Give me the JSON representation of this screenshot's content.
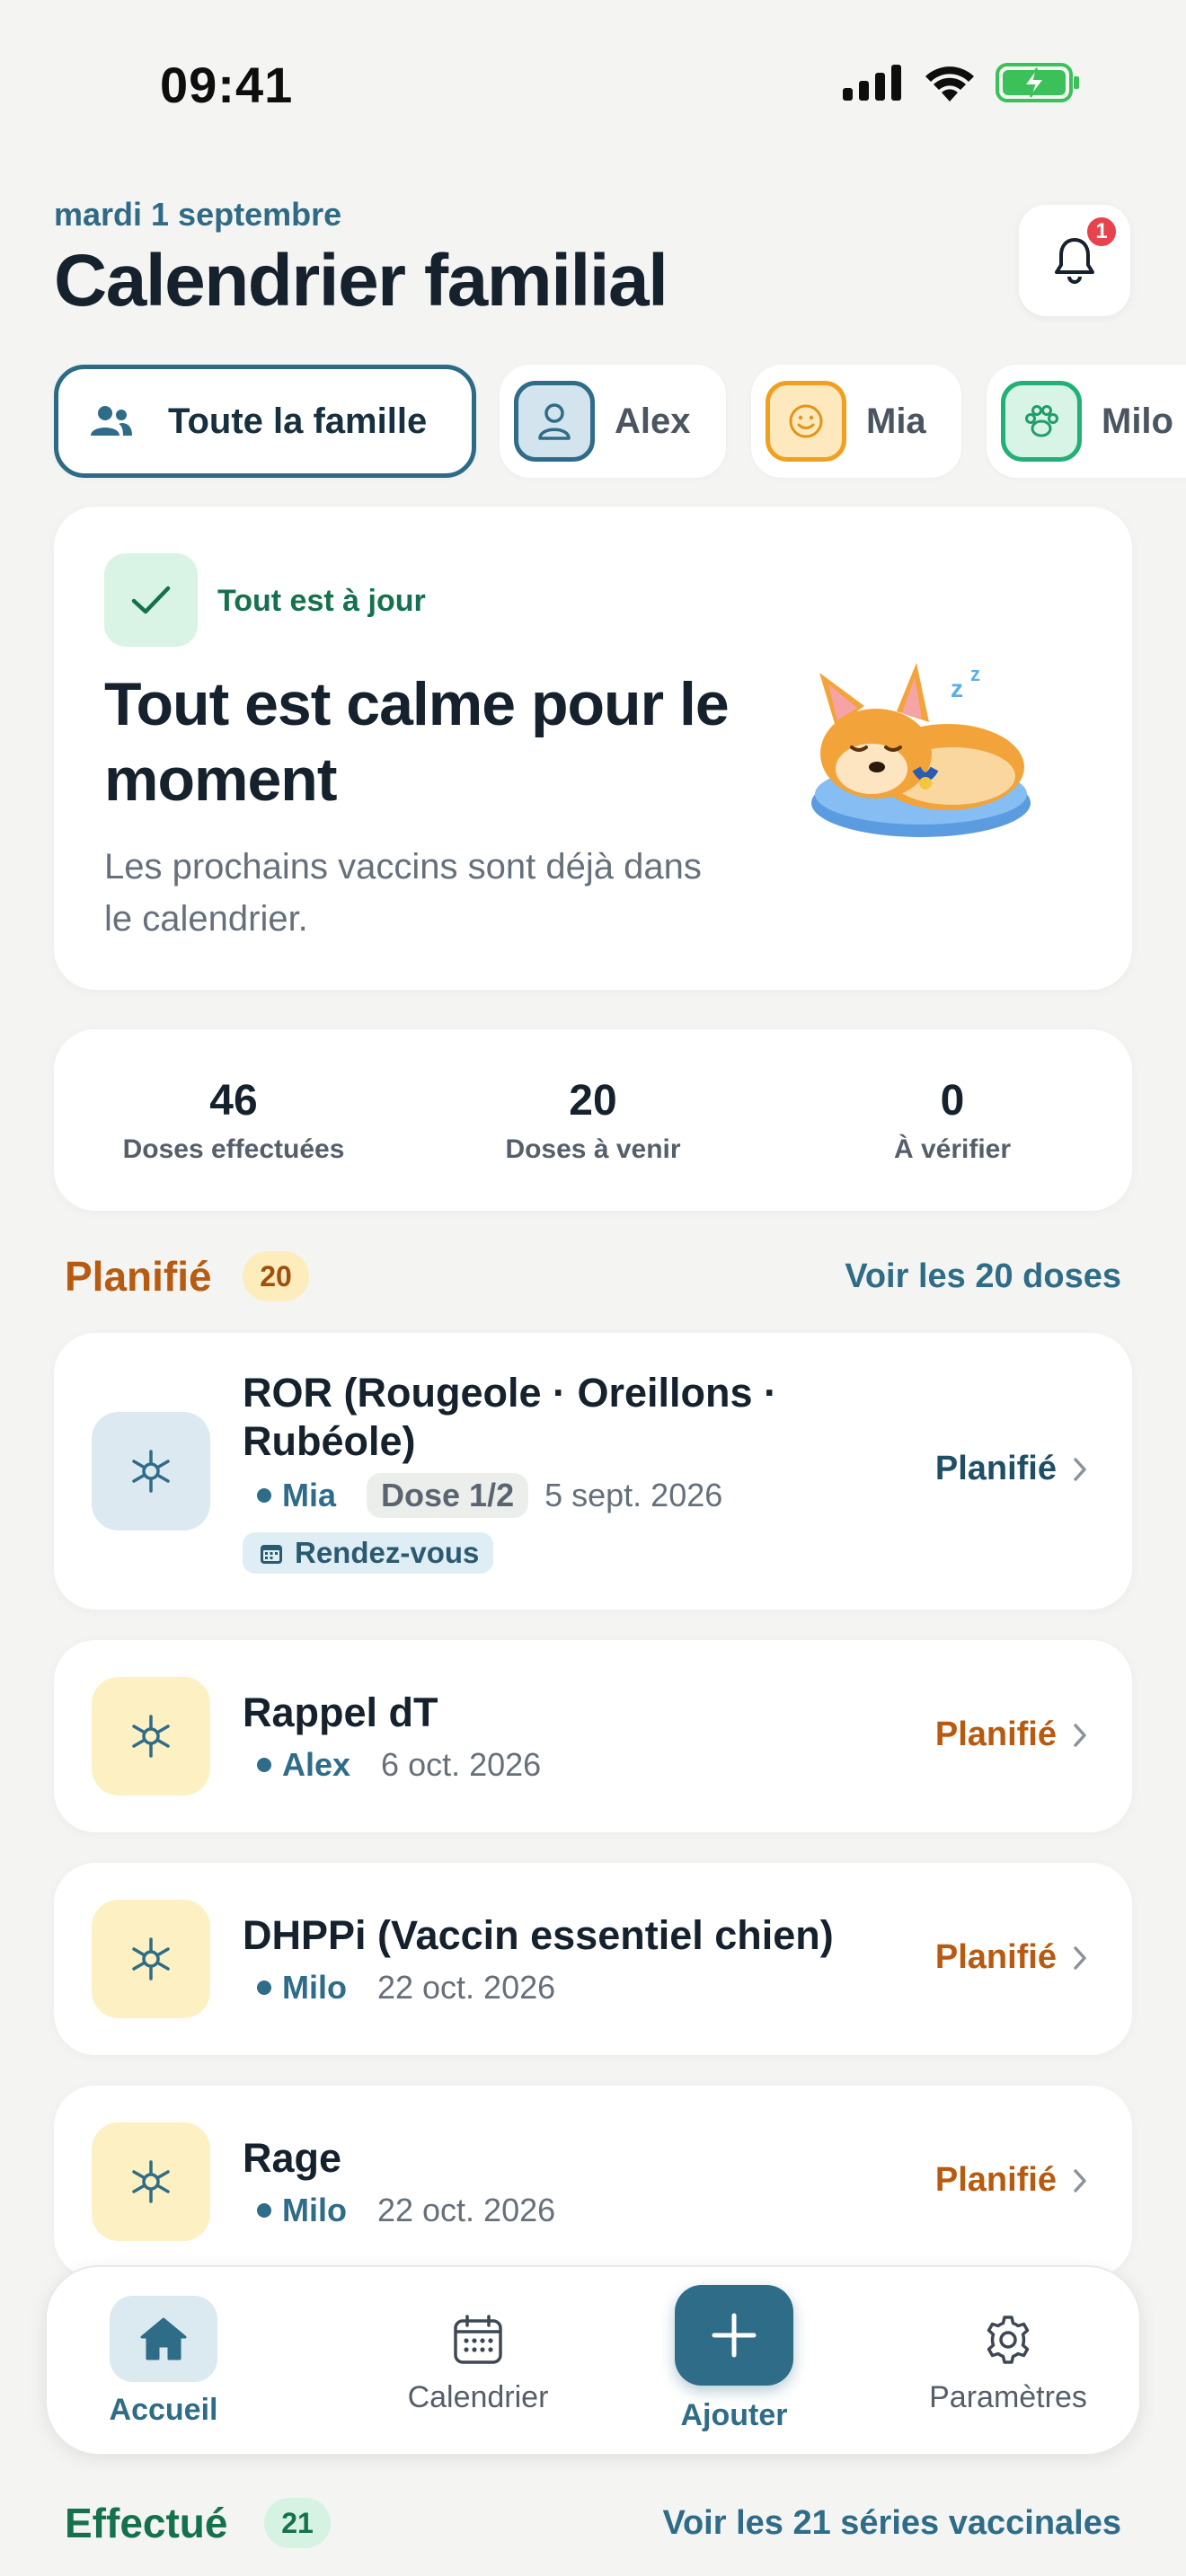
{
  "status_bar": {
    "time": "09:41"
  },
  "header": {
    "date": "mardi 1 septembre",
    "title": "Calendrier familial",
    "notification_count": "1"
  },
  "filters": [
    {
      "label": "Toute la famille",
      "icon": "people-icon",
      "selected": true
    },
    {
      "label": "Alex",
      "icon": "person-icon",
      "color": "#2e6c88"
    },
    {
      "label": "Mia",
      "icon": "smile-icon",
      "color": "#f0a020"
    },
    {
      "label": "Milo",
      "icon": "paw-icon",
      "color": "#22b077"
    }
  ],
  "calm_card": {
    "tag": "Tout est à jour",
    "title": "Tout est calme pour le moment",
    "subtitle": "Les prochains vaccins sont déjà dans le calendrier."
  },
  "stats": [
    {
      "value": "46",
      "label": "Doses effectuées"
    },
    {
      "value": "20",
      "label": "Doses à venir"
    },
    {
      "value": "0",
      "label": "À vérifier"
    }
  ],
  "planned": {
    "title": "Planifié",
    "count": "20",
    "link": "Voir les 20 doses",
    "items": [
      {
        "name": "ROR (Rougeole · Oreillons · Rubéole)",
        "who": "Mia",
        "dose": "Dose 1/2",
        "date": "5 sept. 2026",
        "tag": "Rendez-vous",
        "status": "Planifié"
      },
      {
        "name": "Rappel dT",
        "who": "Alex",
        "date": "6 oct. 2026",
        "status": "Planifié"
      },
      {
        "name": "DHPPi (Vaccin essentiel chien)",
        "who": "Milo",
        "date": "22 oct. 2026",
        "status": "Planifié"
      },
      {
        "name": "Rage",
        "who": "Milo",
        "date": "22 oct. 2026",
        "status": "Planifié"
      }
    ]
  },
  "done": {
    "title": "Effectué",
    "count": "21",
    "link": "Voir les 21 séries vaccinales"
  },
  "nav": {
    "home": "Accueil",
    "calendar": "Calendrier",
    "add": "Ajouter",
    "settings": "Paramètres"
  },
  "colors": {
    "accent": "#2e6c88",
    "planned": "#b85a10",
    "done": "#15714d"
  }
}
